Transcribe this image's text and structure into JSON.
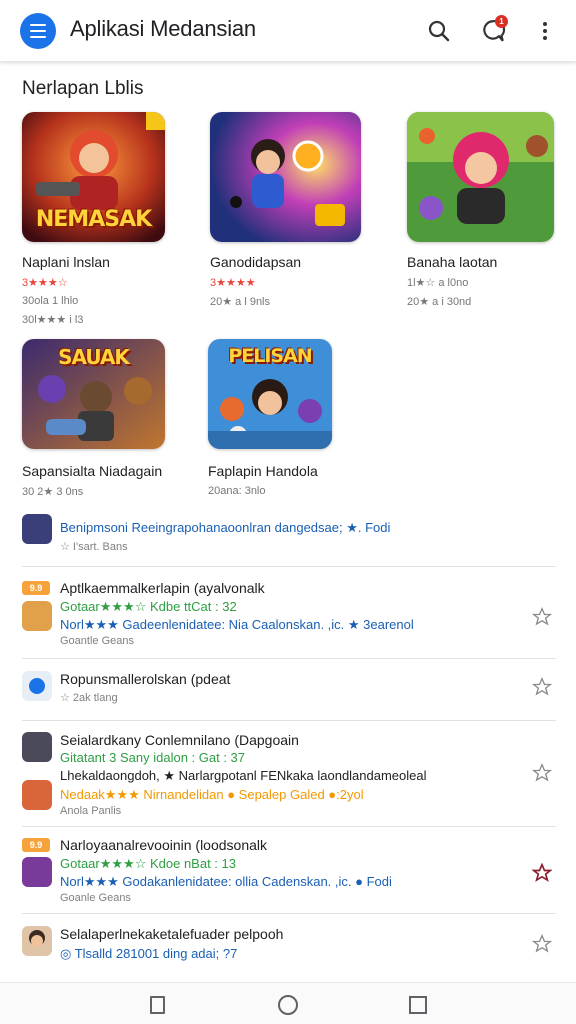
{
  "appbar": {
    "title": "Aplikasi Medansian",
    "icons": [
      "menu-icon",
      "search-icon",
      "notification-icon",
      "more-vert-icon"
    ],
    "notification_count": "1",
    "accent": "#1a73e8"
  },
  "featured": {
    "section_title": "Nerlapan Lblis",
    "cards": [
      {
        "thumb_text": "NEMASAK",
        "name": "Naplani lnslan",
        "meta1": "3★★★☆",
        "meta2": "30ola 1 lhlo",
        "meta3": "30l★★★ i l3"
      },
      {
        "thumb_text": "",
        "name": "Ganodidapsan",
        "meta1": "3★★★★",
        "meta2": "20★ a l 9nls"
      },
      {
        "thumb_text": "",
        "name": "Banaha laotan",
        "meta1": "1l★☆ a l0no",
        "meta2": "20★ a i 30nd"
      },
      {
        "thumb_text": "SAUAK",
        "name": "Sapansialta Niadagain",
        "meta1": "30 2★ 3 0ns"
      },
      {
        "thumb_text": "PELISAN",
        "name": "Faplapin Handola",
        "meta1": "20ana: 3nlo"
      }
    ]
  },
  "list": [
    {
      "line1": "Benipmsoni Reeingrapohanaoonlran dangedsae; ★. Fodi",
      "line2": "☆ I'sart. Bans"
    },
    {
      "tag": "9.9",
      "line1": "Aptlkaemmalkerlapin (ayalvonalk",
      "line2": "Gotaar★★★☆ Kdbe ttCat : 32",
      "line3": "Norl★★★ Gadeenlenidatee: Nia Caalonskan. ,ic. ★ 3earenol",
      "line4": "Goantle Geans"
    },
    {
      "line1": "Ropunsmallerolskan (pdeat",
      "line2": "☆ 2ak tlang"
    },
    {
      "line1": "Seialardkany Conlemnilano (Dapgoain",
      "line2": "Gitatant 3 Sany idalon : Gat : 37",
      "line3": "Lhekaldaongdoh, ★ Narlargpotanl FENkaka laondlandameoleal",
      "line4": "Nedaak★★★ Nirnandelidan ● Sepalep Galed ●:2yol",
      "line5": "Anola Panlis"
    },
    {
      "tag": "9.9",
      "line1": "Narloyaanalrevooinin (loodsonalk",
      "line2": "Gotaar★★★☆ Kdoe nBat : 13",
      "line3": "Norl★★★ Godakanlenidatee: ollia Cadenskan. ,ic. ● Fodi",
      "line4": "Goanle Geans"
    },
    {
      "line1": "Selalaperlnekaketalefuader pelpooh",
      "line2": "◎ Tlsalld 281001 ding adai; ?7"
    }
  ],
  "navbar": {
    "icons": [
      "back-icon",
      "home-icon",
      "recents-icon"
    ]
  }
}
